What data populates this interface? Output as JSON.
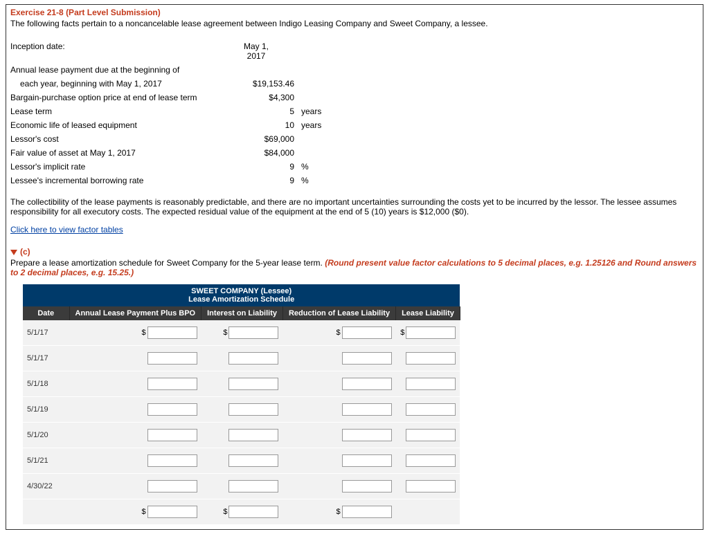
{
  "exercise": {
    "title": "Exercise 21-8 (Part Level Submission)",
    "intro": "The following facts pertain to a noncancelable lease agreement between Indigo Leasing Company and Sweet Company, a lessee."
  },
  "facts": {
    "inception_label": "Inception date:",
    "inception_value_line1": "May 1,",
    "inception_value_line2": "2017",
    "annual_payment_label1": "Annual lease payment due at the beginning of",
    "annual_payment_label2": "each year, beginning with May 1, 2017",
    "annual_payment_value": "$19,153.46",
    "bpo_label": "Bargain-purchase option price at end of lease term",
    "bpo_value": "$4,300",
    "lease_term_label": "Lease term",
    "lease_term_value": "5",
    "lease_term_unit": "years",
    "econ_life_label": "Economic life of leased equipment",
    "econ_life_value": "10",
    "econ_life_unit": "years",
    "lessor_cost_label": "Lessor's cost",
    "lessor_cost_value": "$69,000",
    "fair_value_label": "Fair value of asset at May 1, 2017",
    "fair_value_value": "$84,000",
    "implicit_rate_label": "Lessor's implicit rate",
    "implicit_rate_value": "9",
    "implicit_rate_unit": "%",
    "borrow_rate_label": "Lessee's incremental borrowing rate",
    "borrow_rate_value": "9",
    "borrow_rate_unit": "%"
  },
  "collectibility": "The collectibility of the lease payments is reasonably predictable, and there are no important uncertainties surrounding the costs yet to be incurred by the lessor. The lessee assumes responsibility for all executory costs. The expected residual value of the equipment at the end of 5 (10) years is $12,000 ($0).",
  "factor_link": "Click here to view factor tables",
  "part_c": {
    "marker": "(c)",
    "prepare": "Prepare a lease amortization schedule for Sweet Company for the 5-year lease term. ",
    "round": "(Round present value factor calculations to 5 decimal places, e.g. 1.25126 and Round answers to 2 decimal places, e.g. 15.25.)"
  },
  "schedule": {
    "title1": "SWEET COMPANY (Lessee)",
    "title2": "Lease Amortization Schedule",
    "headers": {
      "date": "Date",
      "payment": "Annual Lease Payment Plus BPO",
      "interest": "Interest on Liability",
      "reduction": "Reduction of Lease Liability",
      "liability": "Lease Liability"
    },
    "dates": [
      "5/1/17",
      "5/1/17",
      "5/1/18",
      "5/1/19",
      "5/1/20",
      "5/1/21",
      "4/30/22"
    ]
  }
}
